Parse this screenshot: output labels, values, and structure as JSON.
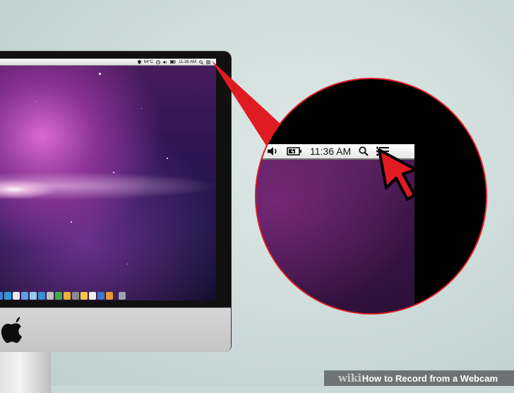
{
  "screen_menubar": {
    "temperature": "64°C",
    "time": "11:36 AM",
    "icons": [
      "shield-icon",
      "temperature-label",
      "clock-icon",
      "volume-icon",
      "battery-icon",
      "time",
      "spotlight-search-icon",
      "notification-list-icon"
    ]
  },
  "zoom_menubar": {
    "time": "11:36 AM",
    "icons": [
      "volume-icon",
      "battery-icon",
      "time",
      "spotlight-search-icon",
      "notification-list-icon"
    ]
  },
  "cursor": {
    "color": "#e01b22"
  },
  "caption": {
    "wiki": "wiki",
    "how": "How",
    "title": "to Record from a Webcam"
  },
  "colors": {
    "accent": "#e01b22",
    "background": "#c9d9d7"
  }
}
